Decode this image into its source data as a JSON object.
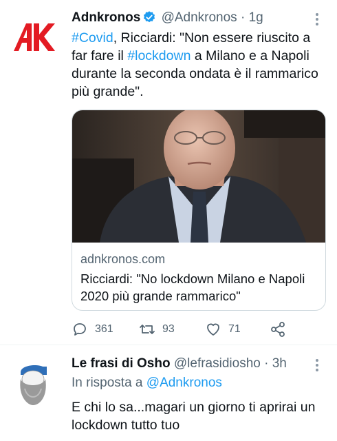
{
  "tweet": {
    "author_name": "Adnkronos",
    "author_handle": "@Adnkronos",
    "separator": "·",
    "time": "1g",
    "text_parts": {
      "hashtag1": "#Covid",
      "t1": ", Ricciardi: \"Non essere riuscito a far fare il ",
      "hashtag2": "#lockdown",
      "t2": " a Milano e a Napoli durante la seconda ondata è il rammarico più grande\"."
    },
    "card": {
      "domain": "adnkronos.com",
      "title": "Ricciardi: \"No lockdown Milano e Napoli 2020 più grande rammarico\""
    },
    "stats": {
      "replies": "361",
      "retweets": "93",
      "likes": "71"
    }
  },
  "reply": {
    "author_name": "Le frasi di Osho",
    "author_handle": "@lefrasidiosho",
    "separator": "·",
    "time": "3h",
    "replying_prefix": "In risposta a ",
    "replying_to": "@Adnkronos",
    "text": "E chi lo sa...magari un giorno ti aprirai un lockdown tutto tuo"
  },
  "colors": {
    "accent": "#1d9bf0",
    "brand_adnkronos": "#e31b23",
    "secondary_text": "#536471"
  },
  "icons": [
    "adnkronos-logo-icon",
    "verified-badge-icon",
    "more-icon",
    "reply-icon",
    "retweet-icon",
    "like-icon",
    "share-icon",
    "osho-avatar-icon"
  ]
}
